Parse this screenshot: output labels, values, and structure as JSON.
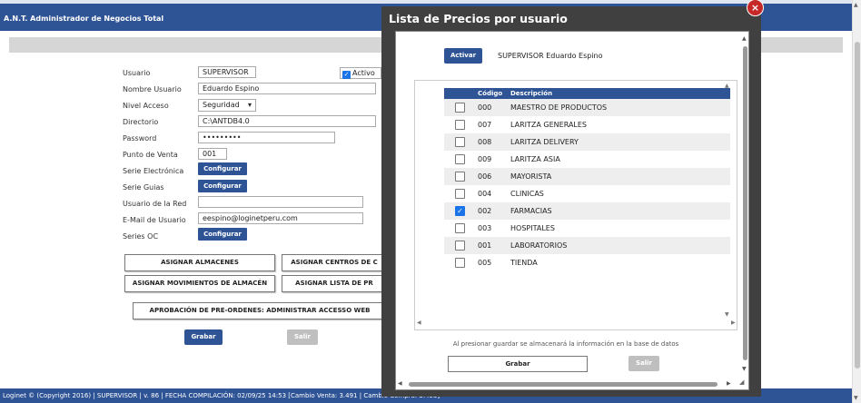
{
  "app": {
    "title": "A.N.T. Administrador de Negocios Total"
  },
  "form": {
    "labels": {
      "usuario": "Usuario",
      "nombre": "Nombre Usuario",
      "nivel": "Nivel Acceso",
      "directorio": "Directorio",
      "password": "Password",
      "punto_venta": "Punto de Venta",
      "serie_electronica": "Serie Electrónica",
      "serie_guias": "Serie Guias",
      "usuario_red": "Usuario de la Red",
      "email": "E-Mail de Usuario",
      "series_oc": "Series OC"
    },
    "values": {
      "usuario": "SUPERVISOR",
      "nombre": "Eduardo Espino",
      "nivel": "Seguridad",
      "directorio": "C:\\ANTDB4.0",
      "password": "•••••••••",
      "punto_venta": "001",
      "usuario_red": "",
      "email": "eespino@loginetperu.com"
    },
    "activo_label": "Activo",
    "configurar_label": "Configurar"
  },
  "actions": {
    "asignar_almacenes": "ASIGNAR ALMACENES",
    "asignar_centros": "ASIGNAR CENTROS DE C",
    "asignar_movimientos": "ASIGNAR MOVIMIENTOS DE ALMACÉN",
    "asignar_lista": "ASIGNAR LISTA DE PR",
    "aprobacion": "APROBACIÓN DE PRE-ORDENES: ADMINISTRAR ACCESSO WEB",
    "grabar": "Grabar",
    "salir": "Salir"
  },
  "footer": {
    "text": "Loginet © (Copyright 2016) | SUPERVISOR | v. 86 | FECHA COMPILACIÓN: 02/09/25 14:53 [Cambio Venta: 3.491 | Cambio Compra: 3.453]"
  },
  "modal": {
    "title": "Lista de Precios por usuario",
    "close_icon": "×",
    "activar_label": "Activar",
    "user_display": "SUPERVISOR  Eduardo Espino",
    "columns": {
      "code": "Código",
      "desc": "Descripción"
    },
    "rows": [
      {
        "code": "000",
        "desc": "MAESTRO DE PRODUCTOS",
        "checked": false
      },
      {
        "code": "007",
        "desc": "LARITZA GENERALES",
        "checked": false
      },
      {
        "code": "008",
        "desc": "LARITZA DELIVERY",
        "checked": false
      },
      {
        "code": "009",
        "desc": "LARITZA ASIA",
        "checked": false
      },
      {
        "code": "006",
        "desc": "MAYORISTA",
        "checked": false
      },
      {
        "code": "004",
        "desc": "CLINICAS",
        "checked": false
      },
      {
        "code": "002",
        "desc": "FARMACIAS",
        "checked": true
      },
      {
        "code": "003",
        "desc": "HOSPITALES",
        "checked": false
      },
      {
        "code": "001",
        "desc": "LABORATORIOS",
        "checked": false
      },
      {
        "code": "005",
        "desc": "TIENDA",
        "checked": false
      }
    ],
    "hint": "Al presionar guardar se almacenará la información en la base de datos",
    "grabar": "Grabar",
    "salir": "Salir"
  },
  "colors": {
    "primary": "#2f5496",
    "checkbox": "#1a73e8",
    "close": "#c62828",
    "modal_bg": "#404040"
  }
}
